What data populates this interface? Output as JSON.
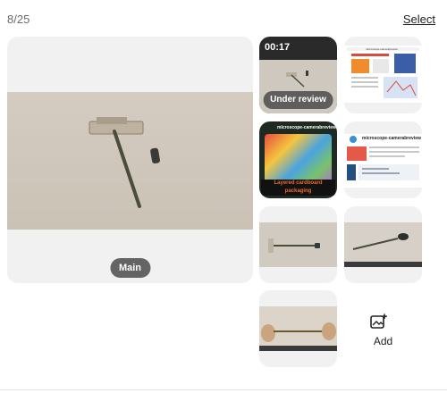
{
  "header": {
    "counter": "8/25",
    "select_label": "Select"
  },
  "main_photo": {
    "badge": "Main"
  },
  "video": {
    "duration": "00:17",
    "status": "Under review"
  },
  "thumbnails": {
    "web_screenshot_1": {
      "heading": "microscope-camera|review"
    },
    "packaging": {
      "heading": "microscope-camerabreview",
      "caption": "Layered cardboard packaging"
    },
    "web_screenshot_2": {
      "heading": "microscope-camerabreview"
    }
  },
  "add": {
    "label": "Add",
    "icon": "add-photos-icon"
  },
  "colors": {
    "pill_bg": "#4b4b4b",
    "packaging_caption": "#f06a2a",
    "tile_bg": "#f1f1f1"
  }
}
